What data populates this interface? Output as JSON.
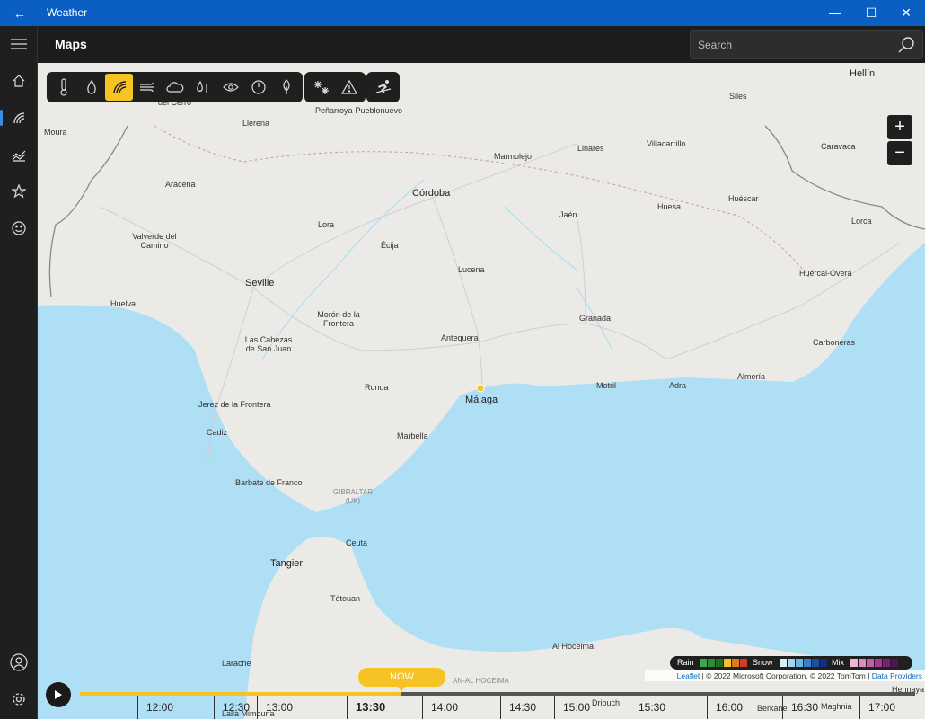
{
  "window": {
    "title": "Weather",
    "back_icon": "back-arrow-icon",
    "minimize": "—",
    "maximize": "☐",
    "close": "✕"
  },
  "header": {
    "page_title": "Maps",
    "search_placeholder": "Search"
  },
  "nav": [
    {
      "name": "menu",
      "icon": "hamburger-icon"
    },
    {
      "name": "forecast",
      "icon": "home-icon"
    },
    {
      "name": "maps",
      "icon": "radar-icon",
      "active": true
    },
    {
      "name": "historical-weather",
      "icon": "chart-icon"
    },
    {
      "name": "favorites",
      "icon": "star-list-icon"
    },
    {
      "name": "life",
      "icon": "smiley-icon"
    }
  ],
  "toolbar_groups": [
    [
      "temperature",
      "precipitation",
      "radar",
      "wind",
      "cloud",
      "humidity",
      "visibility",
      "pressure",
      "pollen"
    ],
    [
      "snow",
      "severe-weather"
    ],
    [
      "ski"
    ]
  ],
  "toolbar_selected": "radar",
  "map_labels": [
    {
      "text": "Hellín"
    },
    {
      "text": "del Cerro"
    },
    {
      "text": "Peñarroya-Pueblonuevo"
    },
    {
      "text": "Moura"
    },
    {
      "text": "Llerena"
    },
    {
      "text": "Siles"
    },
    {
      "text": "Linares"
    },
    {
      "text": "Villacarrillo"
    },
    {
      "text": "Marmolejo"
    },
    {
      "text": "Caravaca"
    },
    {
      "text": "Aracena"
    },
    {
      "text": "Córdoba"
    },
    {
      "text": "Huéscar"
    },
    {
      "text": "Jaén"
    },
    {
      "text": "Huesa"
    },
    {
      "text": "Lorca"
    },
    {
      "text": "Lora"
    },
    {
      "text": "Valverde del Camino"
    },
    {
      "text": "Écija"
    },
    {
      "text": "Lucena"
    },
    {
      "text": "Huércal-Overa"
    },
    {
      "text": "Seville"
    },
    {
      "text": "Huelva"
    },
    {
      "text": "Morón de la Frontera"
    },
    {
      "text": "Granada"
    },
    {
      "text": "Antequera"
    },
    {
      "text": "Las Cabezas de San Juan"
    },
    {
      "text": "Carboneras"
    },
    {
      "text": "Almería"
    },
    {
      "text": "Motril"
    },
    {
      "text": "Adra"
    },
    {
      "text": "Ronda"
    },
    {
      "text": "Málaga"
    },
    {
      "text": "Jerez de la Frontera"
    },
    {
      "text": "Cadiz"
    },
    {
      "text": "Marbella"
    },
    {
      "text": "Barbate de Franco"
    },
    {
      "text": "GIBRALTAR (UK)"
    },
    {
      "text": "Ceuta"
    },
    {
      "text": "Tangier"
    },
    {
      "text": "Tétouan"
    },
    {
      "text": "Al Hoceima"
    },
    {
      "text": "Larache"
    },
    {
      "text": "AN-AL HOCEIMA"
    },
    {
      "text": "Driouch"
    },
    {
      "text": "Berkane"
    },
    {
      "text": "Maghnia"
    },
    {
      "text": "Hennaya"
    },
    {
      "text": "Lalla Mimouna"
    }
  ],
  "zoom": {
    "in": "+",
    "out": "−"
  },
  "legend": {
    "rain_label": "Rain",
    "snow_label": "Snow",
    "mix_label": "Mix",
    "rain_colors": [
      "#3fa34d",
      "#2e8b3a",
      "#1f6b2a",
      "#f2c12e",
      "#e07a1f",
      "#d23a2a"
    ],
    "snow_colors": [
      "#d7ecf7",
      "#a8d3ee",
      "#6fb3e0",
      "#3a7fc8",
      "#1f4ea0",
      "#142f7a"
    ],
    "mix_colors": [
      "#f1b6d6",
      "#e08cc0",
      "#c95ca8",
      "#a8378f",
      "#7d1f76",
      "#551060"
    ]
  },
  "attribution": {
    "leaflet": "Leaflet",
    "middle": " | © 2022 Microsoft Corporation, © 2022 TomTom | ",
    "providers": "Data Providers"
  },
  "timeline": {
    "now_label": "NOW",
    "progress": 0.385,
    "times": [
      "12:00",
      "12:30",
      "13:00",
      "13:30",
      "14:00",
      "14:30",
      "15:00",
      "15:30",
      "16:00",
      "16:30",
      "17:00"
    ],
    "current": "13:30"
  }
}
